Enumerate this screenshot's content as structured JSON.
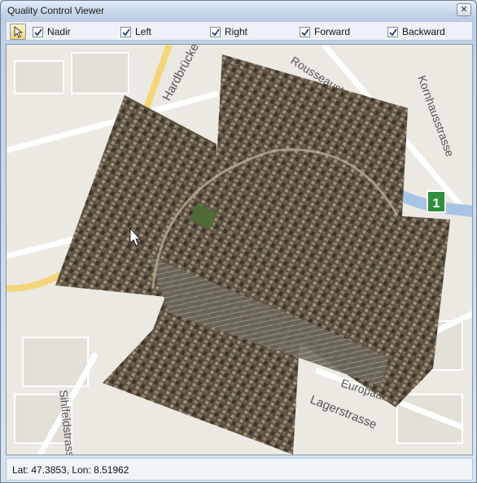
{
  "window": {
    "title": "Quality Control Viewer"
  },
  "toolbar": {
    "checkboxes": [
      {
        "label": "Nadir",
        "checked": true
      },
      {
        "label": "Left",
        "checked": true
      },
      {
        "label": "Right",
        "checked": true
      },
      {
        "label": "Forward",
        "checked": true
      },
      {
        "label": "Backward",
        "checked": true
      }
    ]
  },
  "map": {
    "street_labels": [
      "Hardbrücke",
      "Rousseaustrasse",
      "Kornhausstrasse",
      "Sihlfeldstrasse",
      "Lagerstrasse",
      "Europaallee"
    ],
    "route_badge": "1"
  },
  "status": {
    "coords": "Lat: 47.3853, Lon: 8.51962"
  }
}
